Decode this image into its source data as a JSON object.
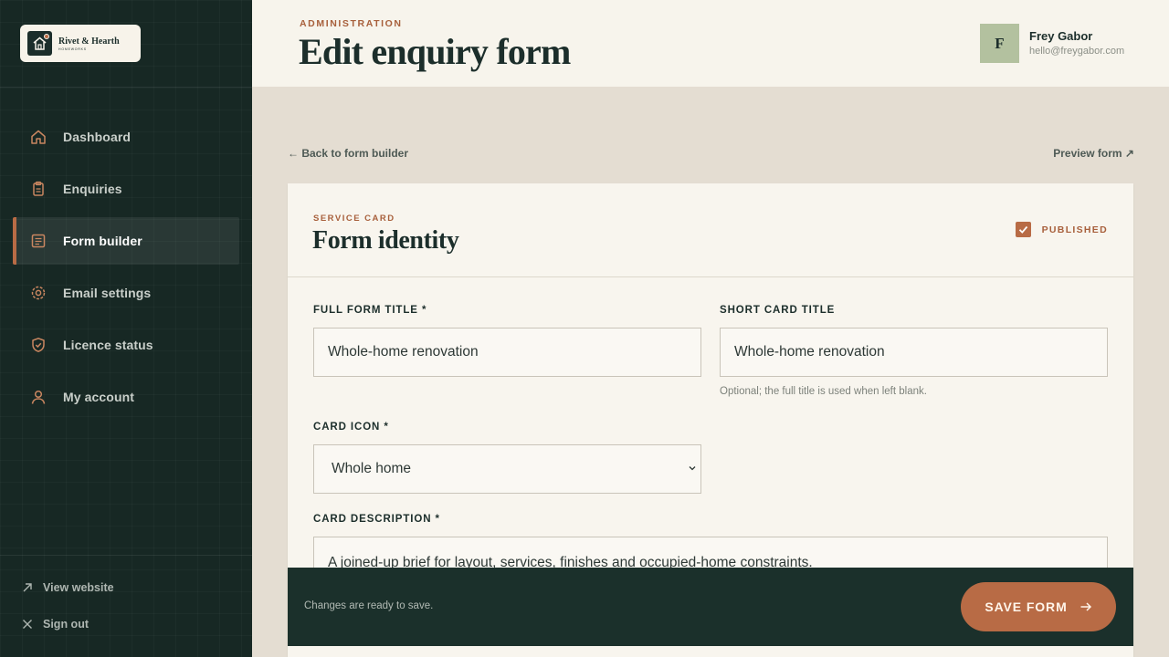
{
  "brand": {
    "name": "Rivet & Hearth",
    "tagline": "HOMEWORKS"
  },
  "sidebar": {
    "items": [
      {
        "label": "Dashboard",
        "icon": "home-icon",
        "active": false
      },
      {
        "label": "Enquiries",
        "icon": "clipboard-icon",
        "active": false
      },
      {
        "label": "Form builder",
        "icon": "form-icon",
        "active": true
      },
      {
        "label": "Email settings",
        "icon": "gear-icon",
        "active": false
      },
      {
        "label": "Licence status",
        "icon": "shield-check-icon",
        "active": false
      },
      {
        "label": "My account",
        "icon": "user-icon",
        "active": false
      }
    ],
    "footer": [
      {
        "label": "View website",
        "icon": "external-arrow-icon"
      },
      {
        "label": "Sign out",
        "icon": "close-icon"
      }
    ]
  },
  "header": {
    "eyebrow": "ADMINISTRATION",
    "title": "Edit enquiry form",
    "user": {
      "initial": "F",
      "name": "Frey Gabor",
      "email": "hello@freygabor.com"
    }
  },
  "links": {
    "back": "← Back to form builder",
    "preview": "Preview form ↗"
  },
  "card": {
    "eyebrow": "SERVICE CARD",
    "title": "Form identity",
    "published_label": "PUBLISHED",
    "published": true,
    "fields": {
      "full_title": {
        "label": "FULL FORM TITLE *",
        "value": "Whole-home renovation"
      },
      "short_title": {
        "label": "SHORT CARD TITLE",
        "value": "Whole-home renovation",
        "help": "Optional; the full title is used when left blank."
      },
      "card_icon": {
        "label": "CARD ICON *",
        "value": "Whole home"
      },
      "card_description": {
        "label": "CARD DESCRIPTION *",
        "value": "A joined-up brief for layout, services, finishes and occupied-home constraints."
      }
    }
  },
  "savebar": {
    "status": "Changes are ready to save.",
    "button": "SAVE FORM"
  },
  "colors": {
    "accent": "#b86b45",
    "sidebar": "#172824",
    "savebar": "#1b302b",
    "avatar": "#b3c19f"
  }
}
